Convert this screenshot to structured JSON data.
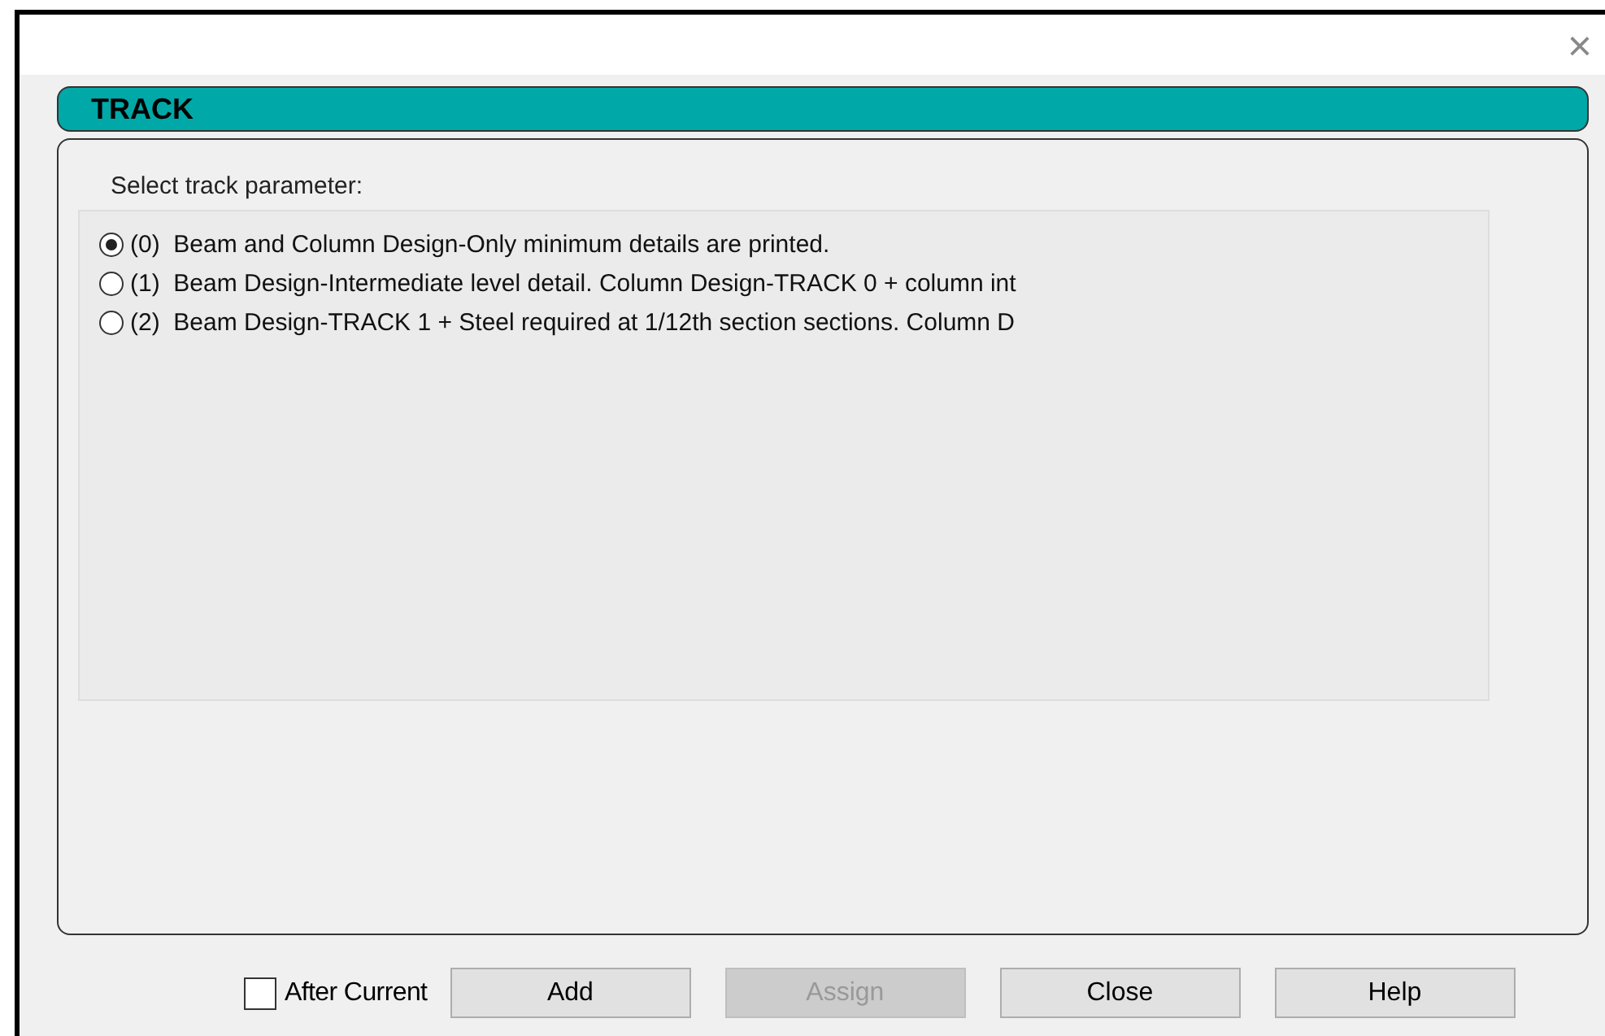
{
  "window": {
    "close": "×"
  },
  "panel": {
    "title": "TRACK",
    "prompt": "Select track parameter:",
    "options": [
      {
        "label": "(0)  Beam and Column Design-Only minimum details are printed.",
        "selected": true
      },
      {
        "label": "(1)  Beam Design-Intermediate level detail. Column Design-TRACK 0 + column int",
        "selected": false
      },
      {
        "label": "(2)  Beam Design-TRACK 1 + Steel required at 1/12th section sections. Column D",
        "selected": false
      }
    ]
  },
  "after_current": {
    "label": "After Current",
    "checked": false
  },
  "buttons": [
    {
      "label": "Add",
      "disabled": false
    },
    {
      "label": "Assign",
      "disabled": true
    },
    {
      "label": "Close",
      "disabled": false
    },
    {
      "label": "Help",
      "disabled": false
    }
  ]
}
